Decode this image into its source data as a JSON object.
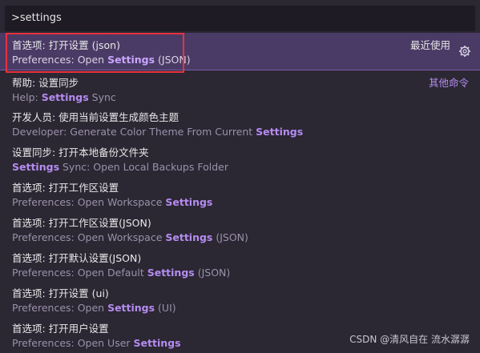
{
  "search": {
    "value": ">settings"
  },
  "items": [
    {
      "l1": "首选项: 打开设置 (json)",
      "l2_pre": "Preferences: Open ",
      "l2_hl": "Settings",
      "l2_post": " (JSON)",
      "right": "最近使用"
    },
    {
      "l1": "帮助: 设置同步",
      "l2_pre": "Help: ",
      "l2_hl": "Settings",
      "l2_post": " Sync",
      "right": "其他命令"
    },
    {
      "l1": "开发人员: 使用当前设置生成颜色主题",
      "l2_pre": "Developer: Generate Color Theme From Current ",
      "l2_hl": "Settings",
      "l2_post": ""
    },
    {
      "l1": "设置同步: 打开本地备份文件夹",
      "l2_pre": "",
      "l2_hl": "Settings",
      "l2_post": " Sync: Open Local Backups Folder"
    },
    {
      "l1": "首选项: 打开工作区设置",
      "l2_pre": "Preferences: Open Workspace ",
      "l2_hl": "Settings",
      "l2_post": ""
    },
    {
      "l1": "首选项: 打开工作区设置(JSON)",
      "l2_pre": "Preferences: Open Workspace ",
      "l2_hl": "Settings",
      "l2_post": " (JSON)"
    },
    {
      "l1": "首选项: 打开默认设置(JSON)",
      "l2_pre": "Preferences: Open Default ",
      "l2_hl": "Settings",
      "l2_post": " (JSON)"
    },
    {
      "l1": "首选项: 打开设置 (ui)",
      "l2_pre": "Preferences: Open ",
      "l2_hl": "Settings",
      "l2_post": " (UI)"
    },
    {
      "l1": "首选项: 打开用户设置",
      "l2_pre": "Preferences: Open User ",
      "l2_hl": "Settings",
      "l2_post": ""
    }
  ],
  "watermark": "CSDN @清风自在 流水潺潺",
  "colors": {
    "accent": "#b58cf0",
    "selected_bg": "#4a3b66",
    "highlight_box": "#e8323c"
  }
}
